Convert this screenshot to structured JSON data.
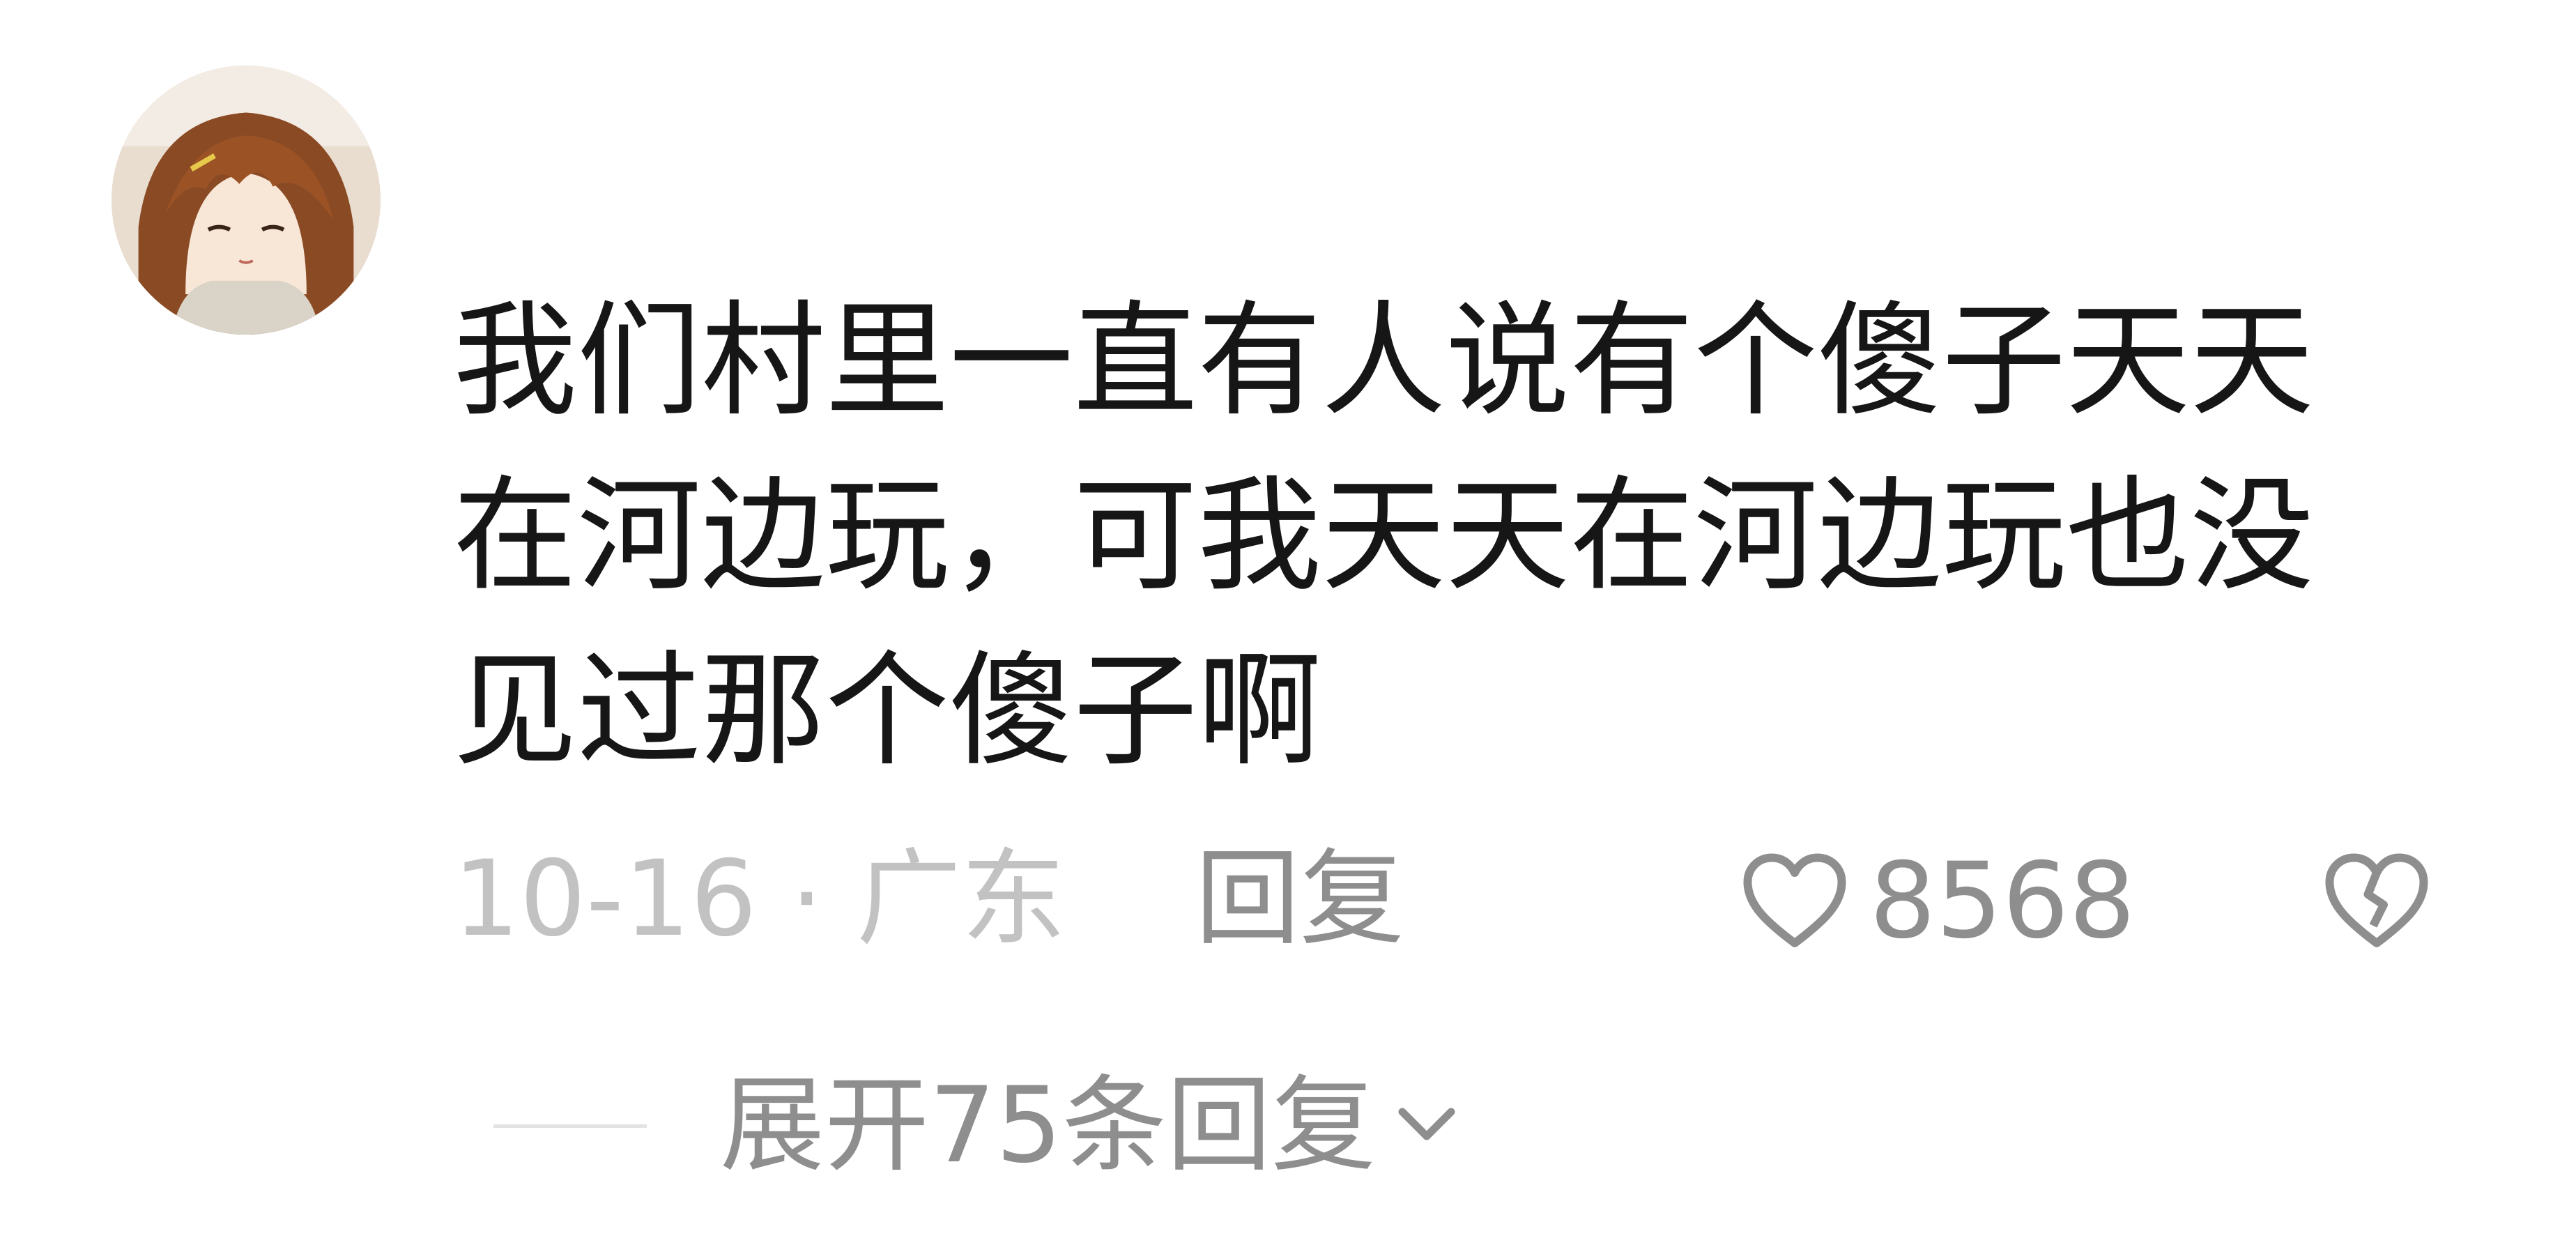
{
  "comment": {
    "avatar_icon": "anime-girl-avatar",
    "lines": [
      "我们村里一直有人说有个傻子天天",
      "在河边玩，可我天天在河边玩也没",
      "见过那个傻子啊"
    ],
    "date_location": "10-16 · 广东",
    "reply_label": "回复",
    "likes": "8568",
    "like_icon": "heart-outline-icon",
    "dislike_icon": "broken-heart-icon",
    "expand_label": "展开75条回复",
    "expand_icon": "chevron-down-icon"
  },
  "colors": {
    "text_primary": "#161616",
    "text_secondary": "#8e8e8e",
    "text_muted": "#c2c2c2",
    "background": "#ffffff"
  }
}
